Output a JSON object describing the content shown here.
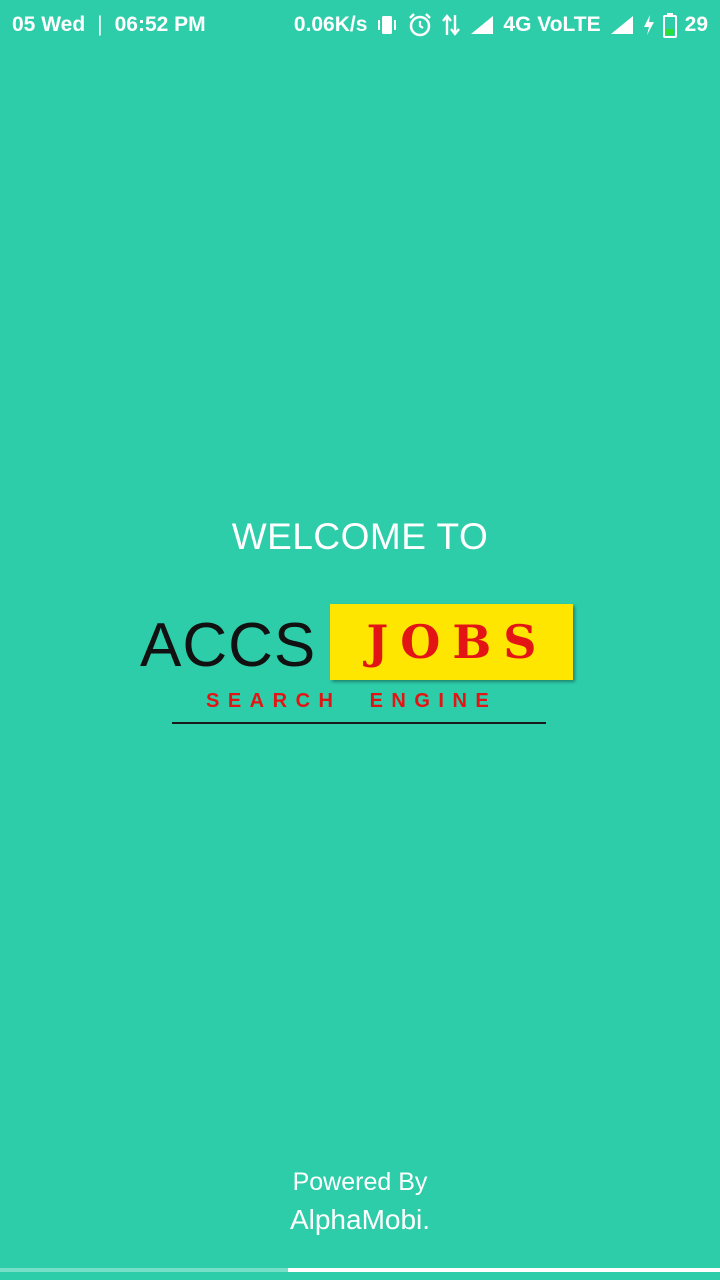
{
  "status_bar": {
    "date": "05 Wed",
    "separator": "|",
    "time": "06:52 PM",
    "net_speed": "0.06K/s",
    "network": "4G VoLTE",
    "battery": "29",
    "icons": [
      "vibrate-icon",
      "alarm-icon",
      "data-arrows-icon",
      "signal-icon",
      "signal-icon",
      "charging-icon",
      "battery-icon"
    ]
  },
  "welcome": {
    "text": "WELCOME TO"
  },
  "logo": {
    "part1": "ACCS",
    "part2": "JOBS",
    "tagline": "SEARCH  ENGINE",
    "colors": {
      "part1": "#111111",
      "part2": "#e31414",
      "part2_bg": "#ffe600",
      "tagline": "#e31414"
    }
  },
  "footer": {
    "powered_by": "Powered By",
    "company": "AlphaMobi."
  },
  "progress": {
    "fraction": 0.6
  },
  "colors": {
    "background": "#2ecdaa",
    "text": "#ffffff"
  }
}
